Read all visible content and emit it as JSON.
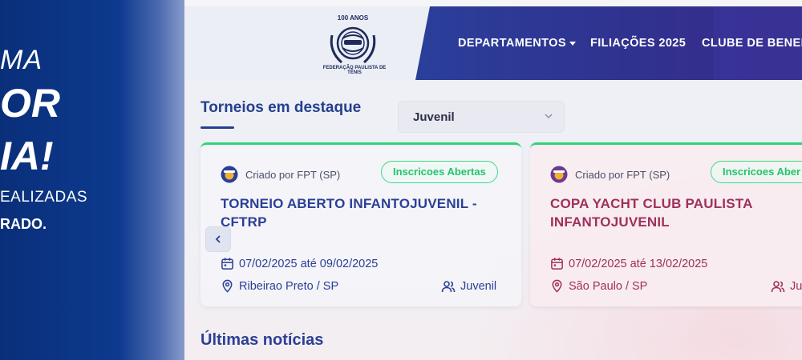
{
  "hero": {
    "line1": "MA",
    "line2": "OR",
    "line3": "IA!",
    "line4": "EALIZADAS",
    "line5": "RADO."
  },
  "logo": {
    "caption": "FEDERAÇÃO PAULISTA DE TÊNIS",
    "top_text": "100 ANOS"
  },
  "nav": {
    "items": [
      {
        "label": "DEPARTAMENTOS"
      },
      {
        "label": "FILIAÇÕES 2025"
      },
      {
        "label": "CLUBE DE BENEFÍ"
      }
    ]
  },
  "featured": {
    "title": "Torneios em destaque",
    "filter": {
      "selected": "Juvenil"
    }
  },
  "cards": [
    {
      "org": "Criado por FPT (SP)",
      "status": "Inscricoes Abertas",
      "title": "TORNEIO ABERTO INFANTOJUVENIL - CFTRP",
      "dates": "07/02/2025 até 09/02/2025",
      "location": "Ribeirao Preto / SP",
      "category": "Juvenil"
    },
    {
      "org": "Criado por FPT (SP)",
      "status": "Inscricoes Aber",
      "title": "COPA YACHT CLUB PAULISTA INFANTOJUVENIL",
      "dates": "07/02/2025 até 13/02/2025",
      "location": "São Paulo / SP",
      "category": "Ju"
    }
  ],
  "news": {
    "title": "Últimas notícias"
  },
  "colors": {
    "brand_blue": "#24408e",
    "nav_bg": "#31318f",
    "open_green": "#24c36e",
    "card2_accent": "#a0305a"
  }
}
